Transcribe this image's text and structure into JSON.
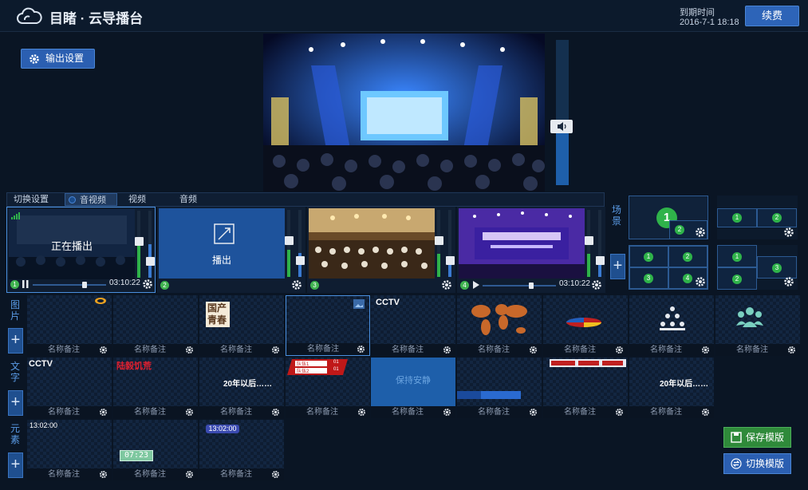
{
  "header": {
    "title": "目睹 · 云导播台",
    "expire_label": "到期时间",
    "expire_value": "2016-7-1 18:18",
    "renew_label": "续费"
  },
  "output_settings_label": "输出设置",
  "tabs": {
    "switch_settings": "切换设置",
    "audio_video": "音视频",
    "video": "视频",
    "audio": "音频"
  },
  "sources": [
    {
      "num": "1",
      "overlay": "正在播出",
      "time": "03:10:22",
      "progress": 0.72,
      "level": 0.55
    },
    {
      "num": "2",
      "overlay": "播出",
      "level": 0.4
    },
    {
      "num": "3",
      "level": 0.35
    },
    {
      "num": "4",
      "time": "03:10:22",
      "progress": 0.68,
      "level": 0.35
    }
  ],
  "side": {
    "images": "图片",
    "text": "文字",
    "elements": "元素",
    "scene": "场景"
  },
  "card_name": "名称备注",
  "image_cards": {
    "logo_text": "国产青春",
    "cctv": "CCTV"
  },
  "text_cards": {
    "cctv": "CCTV",
    "red_text": "陆毅饥荒",
    "later": "20年以后……",
    "later2": "20年以后……",
    "quiet": "保持安静",
    "vs1": "队伍1",
    "vs2": "队伍2",
    "score1": "01",
    "score2": "01"
  },
  "element_cards": {
    "clock1": "13:02:00",
    "timer": "07:23",
    "clock2": "13:02:00"
  },
  "scene": {
    "n1": "1",
    "n2": "2",
    "n3": "3",
    "n4": "4"
  },
  "buttons": {
    "save_template": "保存模版",
    "switch_template": "切换模版"
  },
  "volume_level": 0.4,
  "colors": {
    "accent": "#2d64b8",
    "green": "#2fb34a",
    "bg": "#0a1524"
  }
}
